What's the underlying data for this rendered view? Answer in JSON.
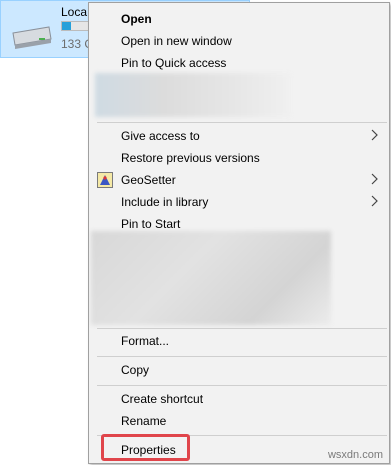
{
  "drive": {
    "name": "Loca",
    "free_text": "133 G",
    "usage_fraction": 0.12,
    "icon": "hard-drive-icon"
  },
  "menu": {
    "open": "Open",
    "open_new_window": "Open in new window",
    "pin_quick_access": "Pin to Quick access",
    "give_access": "Give access to",
    "restore_versions": "Restore previous versions",
    "geosetter": "GeoSetter",
    "include_library": "Include in library",
    "pin_start": "Pin to Start",
    "format": "Format...",
    "copy": "Copy",
    "create_shortcut": "Create shortcut",
    "rename": "Rename",
    "properties": "Properties"
  },
  "icons": {
    "submenu": "chevron-right-icon",
    "geosetter": "geosetter-icon"
  },
  "colors": {
    "highlight": "#e0454b",
    "selection": "#cce8ff"
  },
  "watermark": "wsxdn.com"
}
